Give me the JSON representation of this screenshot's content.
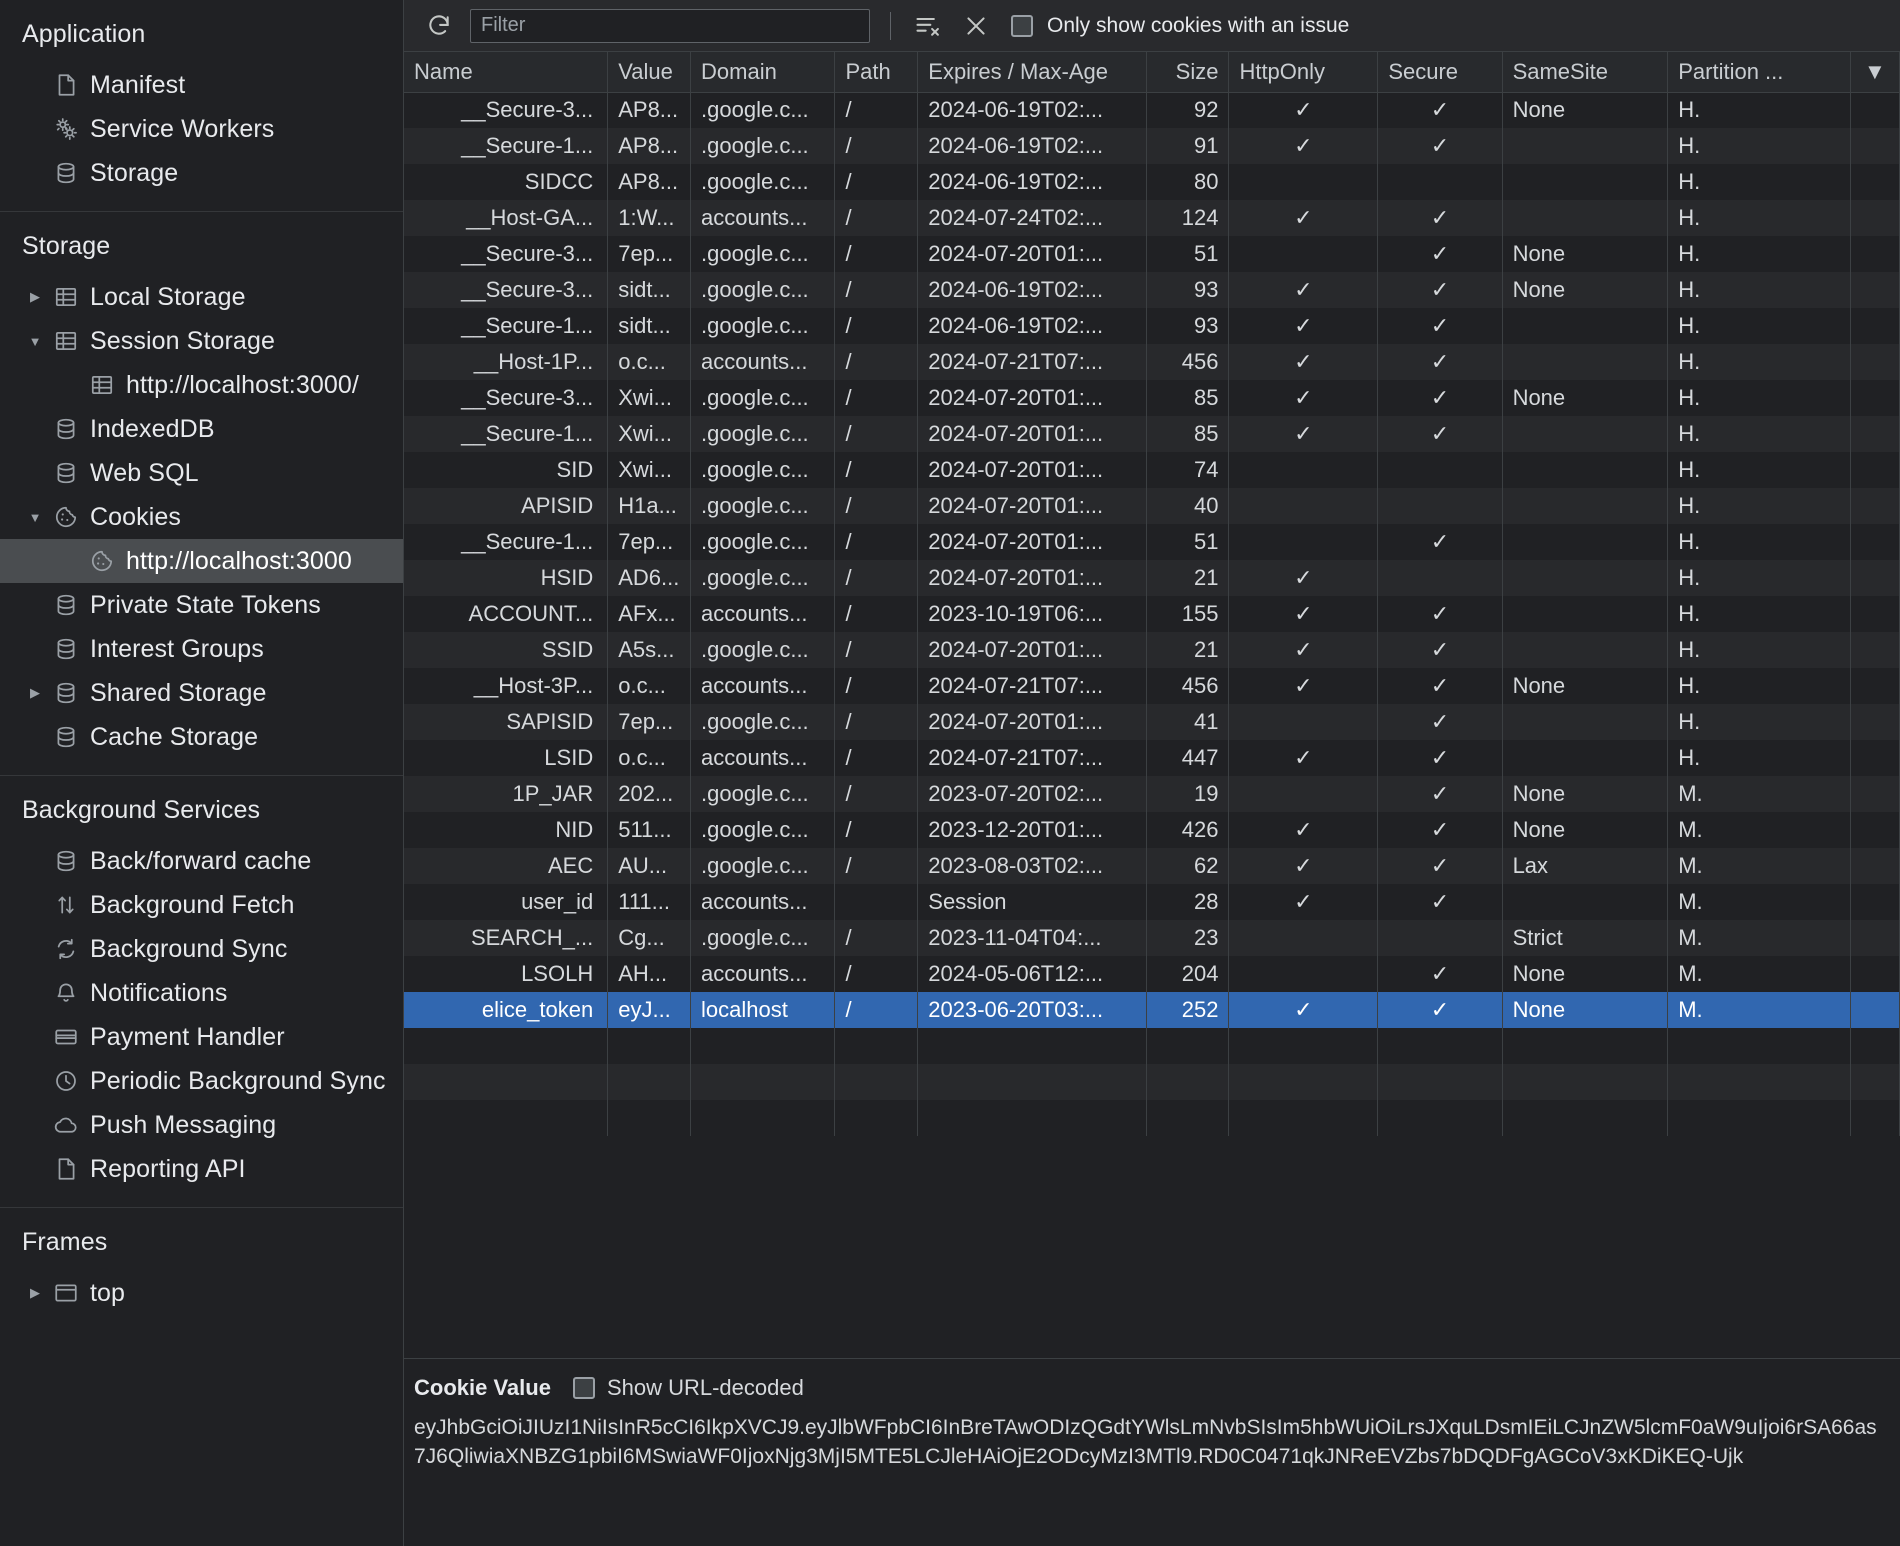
{
  "sidebar": {
    "sections": [
      {
        "title": "Application",
        "items": [
          {
            "label": "Manifest",
            "icon": "document-icon",
            "arrow": "none",
            "indent": 1,
            "selected": false
          },
          {
            "label": "Service Workers",
            "icon": "gears-icon",
            "arrow": "none",
            "indent": 1,
            "selected": false
          },
          {
            "label": "Storage",
            "icon": "database-icon",
            "arrow": "none",
            "indent": 1,
            "selected": false
          }
        ]
      },
      {
        "title": "Storage",
        "items": [
          {
            "label": "Local Storage",
            "icon": "table-icon",
            "arrow": "collapsed",
            "indent": 1,
            "selected": false
          },
          {
            "label": "Session Storage",
            "icon": "table-icon",
            "arrow": "expanded",
            "indent": 1,
            "selected": false
          },
          {
            "label": "http://localhost:3000/",
            "icon": "table-icon",
            "arrow": "none",
            "indent": 2,
            "selected": false
          },
          {
            "label": "IndexedDB",
            "icon": "database-icon",
            "arrow": "none",
            "indent": 1,
            "selected": false
          },
          {
            "label": "Web SQL",
            "icon": "database-icon",
            "arrow": "none",
            "indent": 1,
            "selected": false
          },
          {
            "label": "Cookies",
            "icon": "cookie-icon",
            "arrow": "expanded",
            "indent": 1,
            "selected": false
          },
          {
            "label": "http://localhost:3000",
            "icon": "cookie-icon",
            "arrow": "none",
            "indent": 2,
            "selected": true
          },
          {
            "label": "Private State Tokens",
            "icon": "database-icon",
            "arrow": "none",
            "indent": 1,
            "selected": false
          },
          {
            "label": "Interest Groups",
            "icon": "database-icon",
            "arrow": "none",
            "indent": 1,
            "selected": false
          },
          {
            "label": "Shared Storage",
            "icon": "database-icon",
            "arrow": "collapsed",
            "indent": 1,
            "selected": false
          },
          {
            "label": "Cache Storage",
            "icon": "database-icon",
            "arrow": "none",
            "indent": 1,
            "selected": false
          }
        ]
      },
      {
        "title": "Background Services",
        "items": [
          {
            "label": "Back/forward cache",
            "icon": "database-icon",
            "arrow": "none",
            "indent": 1,
            "selected": false
          },
          {
            "label": "Background Fetch",
            "icon": "arrows-updown-icon",
            "arrow": "none",
            "indent": 1,
            "selected": false
          },
          {
            "label": "Background Sync",
            "icon": "sync-icon",
            "arrow": "none",
            "indent": 1,
            "selected": false
          },
          {
            "label": "Notifications",
            "icon": "bell-icon",
            "arrow": "none",
            "indent": 1,
            "selected": false
          },
          {
            "label": "Payment Handler",
            "icon": "credit-card-icon",
            "arrow": "none",
            "indent": 1,
            "selected": false
          },
          {
            "label": "Periodic Background Sync",
            "icon": "clock-icon",
            "arrow": "none",
            "indent": 1,
            "selected": false
          },
          {
            "label": "Push Messaging",
            "icon": "cloud-icon",
            "arrow": "none",
            "indent": 1,
            "selected": false
          },
          {
            "label": "Reporting API",
            "icon": "document-icon",
            "arrow": "none",
            "indent": 1,
            "selected": false
          }
        ]
      },
      {
        "title": "Frames",
        "items": [
          {
            "label": "top",
            "icon": "frame-icon",
            "arrow": "collapsed",
            "indent": 1,
            "selected": false
          }
        ]
      }
    ]
  },
  "toolbar": {
    "refresh_icon": "refresh-icon",
    "filter_placeholder": "Filter",
    "filter_value": "",
    "clear_all_icon": "clear-all-cookies-icon",
    "delete_icon": "delete-selected-cookie-icon",
    "issue_checkbox_label": "Only show cookies with an issue",
    "issue_checkbox_checked": false
  },
  "table": {
    "columns": [
      {
        "key": "name",
        "label": "Name",
        "align": "left"
      },
      {
        "key": "value",
        "label": "Value",
        "align": "left"
      },
      {
        "key": "domain",
        "label": "Domain",
        "align": "left"
      },
      {
        "key": "path",
        "label": "Path",
        "align": "left"
      },
      {
        "key": "expires",
        "label": "Expires / Max-Age",
        "align": "left"
      },
      {
        "key": "size",
        "label": "Size",
        "align": "right"
      },
      {
        "key": "httponly",
        "label": "HttpOnly",
        "align": "left"
      },
      {
        "key": "secure",
        "label": "Secure",
        "align": "left"
      },
      {
        "key": "samesite",
        "label": "SameSite",
        "align": "left"
      },
      {
        "key": "partition",
        "label": "Partition ...",
        "align": "left"
      },
      {
        "key": "sort",
        "label": "▼",
        "align": "center"
      }
    ],
    "check_glyph": "✓",
    "rows": [
      {
        "name": "__Secure-3...",
        "value": "AP8...",
        "domain": ".google.c...",
        "path": "/",
        "expires": "2024-06-19T02:...",
        "size": "92",
        "httponly": "✓",
        "secure": "✓",
        "samesite": "None",
        "partition": "H.",
        "selected": false
      },
      {
        "name": "__Secure-1...",
        "value": "AP8...",
        "domain": ".google.c...",
        "path": "/",
        "expires": "2024-06-19T02:...",
        "size": "91",
        "httponly": "✓",
        "secure": "✓",
        "samesite": "",
        "partition": "H.",
        "selected": false
      },
      {
        "name": "SIDCC",
        "value": "AP8...",
        "domain": ".google.c...",
        "path": "/",
        "expires": "2024-06-19T02:...",
        "size": "80",
        "httponly": "",
        "secure": "",
        "samesite": "",
        "partition": "H.",
        "selected": false
      },
      {
        "name": "__Host-GA...",
        "value": "1:W...",
        "domain": "accounts...",
        "path": "/",
        "expires": "2024-07-24T02:...",
        "size": "124",
        "httponly": "✓",
        "secure": "✓",
        "samesite": "",
        "partition": "H.",
        "selected": false
      },
      {
        "name": "__Secure-3...",
        "value": "7ep...",
        "domain": ".google.c...",
        "path": "/",
        "expires": "2024-07-20T01:...",
        "size": "51",
        "httponly": "",
        "secure": "✓",
        "samesite": "None",
        "partition": "H.",
        "selected": false
      },
      {
        "name": "__Secure-3...",
        "value": "sidt...",
        "domain": ".google.c...",
        "path": "/",
        "expires": "2024-06-19T02:...",
        "size": "93",
        "httponly": "✓",
        "secure": "✓",
        "samesite": "None",
        "partition": "H.",
        "selected": false
      },
      {
        "name": "__Secure-1...",
        "value": "sidt...",
        "domain": ".google.c...",
        "path": "/",
        "expires": "2024-06-19T02:...",
        "size": "93",
        "httponly": "✓",
        "secure": "✓",
        "samesite": "",
        "partition": "H.",
        "selected": false
      },
      {
        "name": "__Host-1P...",
        "value": "o.c...",
        "domain": "accounts...",
        "path": "/",
        "expires": "2024-07-21T07:...",
        "size": "456",
        "httponly": "✓",
        "secure": "✓",
        "samesite": "",
        "partition": "H.",
        "selected": false
      },
      {
        "name": "__Secure-3...",
        "value": "Xwi...",
        "domain": ".google.c...",
        "path": "/",
        "expires": "2024-07-20T01:...",
        "size": "85",
        "httponly": "✓",
        "secure": "✓",
        "samesite": "None",
        "partition": "H.",
        "selected": false
      },
      {
        "name": "__Secure-1...",
        "value": "Xwi...",
        "domain": ".google.c...",
        "path": "/",
        "expires": "2024-07-20T01:...",
        "size": "85",
        "httponly": "✓",
        "secure": "✓",
        "samesite": "",
        "partition": "H.",
        "selected": false
      },
      {
        "name": "SID",
        "value": "Xwi...",
        "domain": ".google.c...",
        "path": "/",
        "expires": "2024-07-20T01:...",
        "size": "74",
        "httponly": "",
        "secure": "",
        "samesite": "",
        "partition": "H.",
        "selected": false
      },
      {
        "name": "APISID",
        "value": "H1a...",
        "domain": ".google.c...",
        "path": "/",
        "expires": "2024-07-20T01:...",
        "size": "40",
        "httponly": "",
        "secure": "",
        "samesite": "",
        "partition": "H.",
        "selected": false
      },
      {
        "name": "__Secure-1...",
        "value": "7ep...",
        "domain": ".google.c...",
        "path": "/",
        "expires": "2024-07-20T01:...",
        "size": "51",
        "httponly": "",
        "secure": "✓",
        "samesite": "",
        "partition": "H.",
        "selected": false
      },
      {
        "name": "HSID",
        "value": "AD6...",
        "domain": ".google.c...",
        "path": "/",
        "expires": "2024-07-20T01:...",
        "size": "21",
        "httponly": "✓",
        "secure": "",
        "samesite": "",
        "partition": "H.",
        "selected": false
      },
      {
        "name": "ACCOUNT...",
        "value": "AFx...",
        "domain": "accounts...",
        "path": "/",
        "expires": "2023-10-19T06:...",
        "size": "155",
        "httponly": "✓",
        "secure": "✓",
        "samesite": "",
        "partition": "H.",
        "selected": false
      },
      {
        "name": "SSID",
        "value": "A5s...",
        "domain": ".google.c...",
        "path": "/",
        "expires": "2024-07-20T01:...",
        "size": "21",
        "httponly": "✓",
        "secure": "✓",
        "samesite": "",
        "partition": "H.",
        "selected": false
      },
      {
        "name": "__Host-3P...",
        "value": "o.c...",
        "domain": "accounts...",
        "path": "/",
        "expires": "2024-07-21T07:...",
        "size": "456",
        "httponly": "✓",
        "secure": "✓",
        "samesite": "None",
        "partition": "H.",
        "selected": false
      },
      {
        "name": "SAPISID",
        "value": "7ep...",
        "domain": ".google.c...",
        "path": "/",
        "expires": "2024-07-20T01:...",
        "size": "41",
        "httponly": "",
        "secure": "✓",
        "samesite": "",
        "partition": "H.",
        "selected": false
      },
      {
        "name": "LSID",
        "value": "o.c...",
        "domain": "accounts...",
        "path": "/",
        "expires": "2024-07-21T07:...",
        "size": "447",
        "httponly": "✓",
        "secure": "✓",
        "samesite": "",
        "partition": "H.",
        "selected": false
      },
      {
        "name": "1P_JAR",
        "value": "202...",
        "domain": ".google.c...",
        "path": "/",
        "expires": "2023-07-20T02:...",
        "size": "19",
        "httponly": "",
        "secure": "✓",
        "samesite": "None",
        "partition": "M.",
        "selected": false
      },
      {
        "name": "NID",
        "value": "511...",
        "domain": ".google.c...",
        "path": "/",
        "expires": "2023-12-20T01:...",
        "size": "426",
        "httponly": "✓",
        "secure": "✓",
        "samesite": "None",
        "partition": "M.",
        "selected": false
      },
      {
        "name": "AEC",
        "value": "AU...",
        "domain": ".google.c...",
        "path": "/",
        "expires": "2023-08-03T02:...",
        "size": "62",
        "httponly": "✓",
        "secure": "✓",
        "samesite": "Lax",
        "partition": "M.",
        "selected": false
      },
      {
        "name": "user_id",
        "value": "111...",
        "domain": "accounts...",
        "path": "",
        "expires": "Session",
        "size": "28",
        "httponly": "✓",
        "secure": "✓",
        "samesite": "",
        "partition": "M.",
        "selected": false
      },
      {
        "name": "SEARCH_...",
        "value": "Cg...",
        "domain": ".google.c...",
        "path": "/",
        "expires": "2023-11-04T04:...",
        "size": "23",
        "httponly": "",
        "secure": "",
        "samesite": "Strict",
        "partition": "M.",
        "selected": false
      },
      {
        "name": "LSOLH",
        "value": "AH...",
        "domain": "accounts...",
        "path": "/",
        "expires": "2024-05-06T12:...",
        "size": "204",
        "httponly": "",
        "secure": "✓",
        "samesite": "None",
        "partition": "M.",
        "selected": false
      },
      {
        "name": "elice_token",
        "value": "eyJ...",
        "domain": "localhost",
        "path": "/",
        "expires": "2023-06-20T03:...",
        "size": "252",
        "httponly": "✓",
        "secure": "✓",
        "samesite": "None",
        "partition": "M.",
        "selected": true
      }
    ]
  },
  "cookie_value_panel": {
    "title": "Cookie Value",
    "url_decoded_label": "Show URL-decoded",
    "url_decoded_checked": false,
    "value": "eyJhbGciOiJIUzI1NiIsInR5cCI6IkpXVCJ9.eyJlbWFpbCI6InBreTAwODIzQGdtYWlsLmNvbSIsIm5hbWUiOiLrsJXquLDsmIEiLCJnZW5lcmF0aW9uIjoi6rSA66as7J6QliwiaXNBZG1pbiI6MSwiaWF0IjoxNjg3MjI5MTE5LCJleHAiOjE2ODcyMzI3MTl9.RD0C0471qkJNReEVZbs7bDQDFgAGCoV3xKDiKEQ-Ujk"
  }
}
